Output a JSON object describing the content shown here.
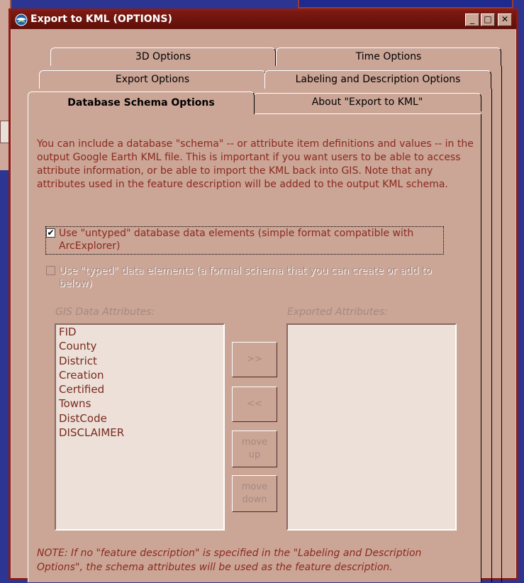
{
  "window": {
    "title": "Export to KML (OPTIONS)",
    "minimize_icon": "minimize-icon",
    "maximize_icon": "maximize-icon",
    "close_icon": "close-icon"
  },
  "tabs": {
    "row1": [
      "3D Options",
      "Time Options"
    ],
    "row2": [
      "Export Options",
      "Labeling and Description Options"
    ],
    "row3": [
      "Database Schema Options",
      "About \"Export to KML\""
    ],
    "active": "Database Schema Options"
  },
  "content": {
    "intro": "You can include a database \"schema\" -- or attribute item definitions and values -- in the output Google Earth KML file. This is important if you want users to be able to access attribute information, or be able to import the KML back into GIS. Note that any attributes used in the feature description will be added to the output KML schema.",
    "untyped_checkbox": {
      "label": "Use \"untyped\" database data elements (simple format compatible with ArcExplorer)",
      "checked": true,
      "enabled": true
    },
    "typed_checkbox": {
      "label": "Use \"typed\" data elements (a formal schema that you can create or add to below)",
      "checked": false,
      "enabled": false
    },
    "gis_label": "GIS Data Attributes:",
    "exported_label": "Exported Attributes:",
    "gis_attributes": [
      "FID",
      "County",
      "District",
      "Creation",
      "Certified",
      "Towns",
      "DistCode",
      "DISCLAIMER"
    ],
    "exported_attributes": [],
    "buttons": {
      "add": ">>",
      "remove": "<<",
      "move_up": "move up",
      "move_down": "move down"
    },
    "note": "NOTE: If no \"feature description\" is specified in the \"Labeling and Description Options\", the schema attributes will be used as the feature description."
  },
  "colors": {
    "title_bar": "#7d1a12",
    "dialog_bg": "#cba596",
    "text": "#8b2a1e",
    "desktop": "#2c3591"
  }
}
